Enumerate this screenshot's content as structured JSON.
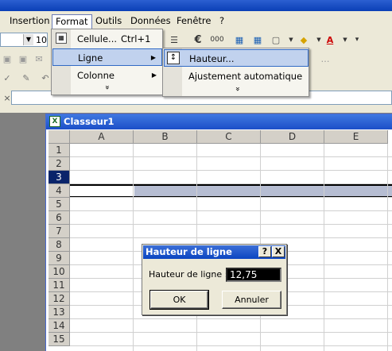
{
  "menubar": {
    "items": [
      {
        "label": "Insertion"
      },
      {
        "label": "Format"
      },
      {
        "label": "Outils"
      },
      {
        "label": "Données"
      },
      {
        "label": "Fenêtre"
      },
      {
        "label": "?"
      }
    ]
  },
  "toolbar": {
    "font_size": "10",
    "number_format_label": "000",
    "euro_label": "€"
  },
  "format_menu": {
    "items": [
      {
        "label": "Cellule...",
        "shortcut": "Ctrl+1"
      },
      {
        "label": "Ligne"
      },
      {
        "label": "Colonne"
      }
    ],
    "more": "»"
  },
  "ligne_submenu": {
    "items": [
      {
        "label": "Hauteur..."
      },
      {
        "label": "Ajustement automatique"
      }
    ],
    "more": "»"
  },
  "workbook": {
    "title": "Classeur1",
    "columns": [
      "A",
      "B",
      "C",
      "D",
      "E"
    ],
    "rows": [
      "1",
      "2",
      "3",
      "4",
      "5",
      "6",
      "7",
      "8",
      "9",
      "10",
      "11",
      "12",
      "13",
      "14",
      "15"
    ]
  },
  "dialog": {
    "title": "Hauteur de ligne",
    "help": "?",
    "close": "X",
    "field_label": "Hauteur de ligne :",
    "field_value": "12,75",
    "ok_label": "OK",
    "cancel_label": "Annuler"
  }
}
